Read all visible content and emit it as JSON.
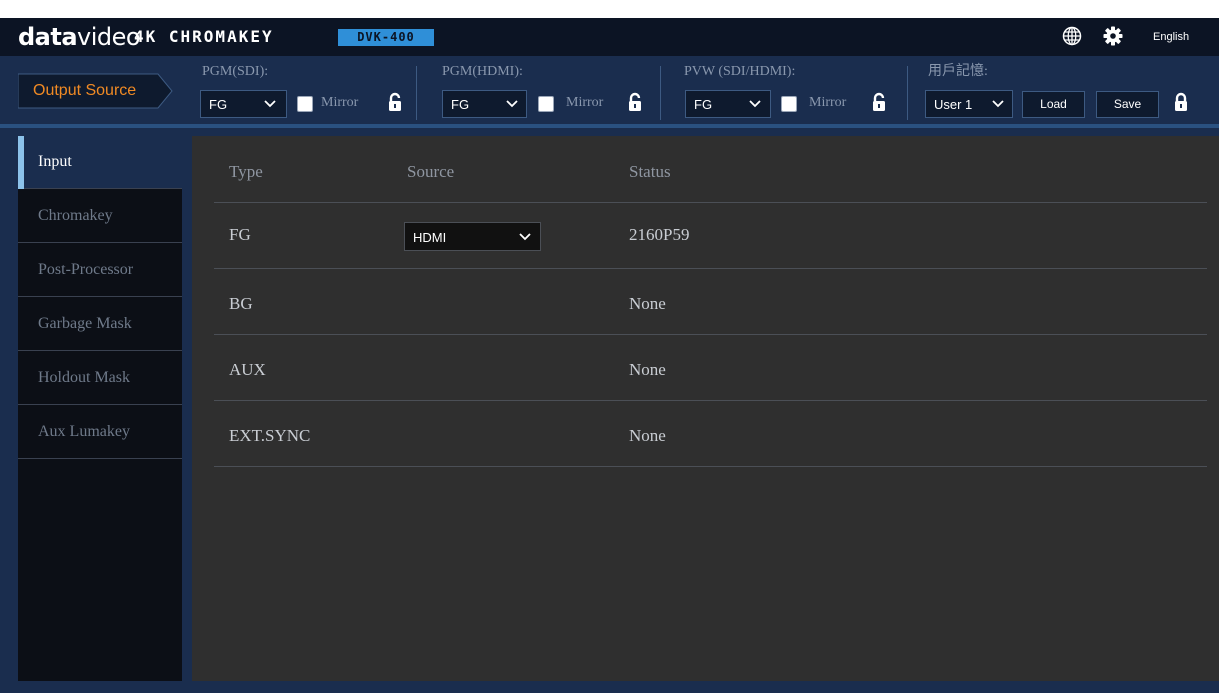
{
  "brand": {
    "logo_bold": "data",
    "logo_light": "video",
    "product": "4K CHROMAKEY",
    "model": "DVK-400"
  },
  "header": {
    "language": "English",
    "icons": [
      "globe-icon",
      "gear-icon"
    ]
  },
  "output_bar": {
    "tab_label": "Output Source",
    "groups": [
      {
        "title": "PGM(SDI):",
        "selected": "FG",
        "mirror_label": "Mirror",
        "mirror_checked": false,
        "locked": true
      },
      {
        "title": "PGM(HDMI):",
        "selected": "FG",
        "mirror_label": "Mirror",
        "mirror_checked": false,
        "locked": true
      },
      {
        "title": "PVW (SDI/HDMI):",
        "selected": "FG",
        "mirror_label": "Mirror",
        "mirror_checked": false,
        "locked": true
      }
    ],
    "memory": {
      "title": "用戶記憶:",
      "selected": "User 1",
      "load_label": "Load",
      "save_label": "Save"
    }
  },
  "sidebar": {
    "items": [
      {
        "label": "Input",
        "active": true
      },
      {
        "label": "Chromakey",
        "active": false
      },
      {
        "label": "Post-Processor",
        "active": false
      },
      {
        "label": "Garbage Mask",
        "active": false
      },
      {
        "label": "Holdout Mask",
        "active": false
      },
      {
        "label": "Aux Lumakey",
        "active": false
      }
    ]
  },
  "table": {
    "headers": {
      "type": "Type",
      "source": "Source",
      "status": "Status"
    },
    "rows": [
      {
        "type": "FG",
        "source": "HDMI",
        "status": "2160P59"
      },
      {
        "type": "BG",
        "source": "",
        "status": "None"
      },
      {
        "type": "AUX",
        "source": "",
        "status": "None"
      },
      {
        "type": "EXT.SYNC",
        "source": "",
        "status": "None"
      }
    ]
  },
  "colors": {
    "accent_orange": "#f08a24",
    "nav_active_bar": "#8cc2ea",
    "badge_blue": "#2f8fd8",
    "bar_bg": "#1a2d4e"
  }
}
